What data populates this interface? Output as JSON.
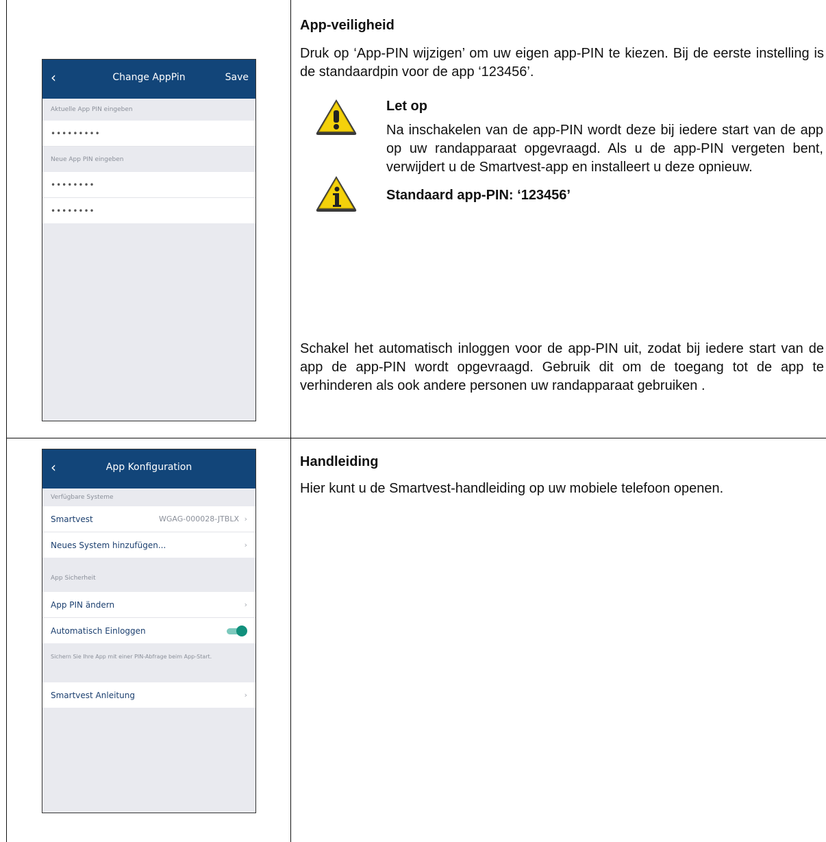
{
  "section1": {
    "phone": {
      "title": "Change AppPin",
      "back_icon": "‹",
      "save_label": "Save",
      "current_pin_label": "Aktuelle App PIN eingeben",
      "current_pin_value": "•••••••••",
      "new_pin_label": "Neue App PIN eingeben",
      "new_pin_value": "••••••••",
      "confirm_pin_value": "••••••••"
    },
    "heading": "App-veiligheid",
    "intro": "Druk op ‘App-PIN wijzigen’ om uw eigen app-PIN te kiezen. Bij de eerste instelling is de standaardpin voor de app ‘123456’.",
    "caution_title": "Let op",
    "caution_text": "Na inschakelen van de app-PIN wordt deze bij iedere start van de app op uw randapparaat opgevraagd. Als u de app-PIN vergeten bent, verwijdert u de Smartvest-app en installeert u deze opnieuw.",
    "info_text": "Standaard app-PIN: ‘123456’",
    "closing": "Schakel het automatisch inloggen voor de app-PIN uit, zodat bij iedere start van de app de app-PIN wordt opgevraagd. Gebruik dit om de toegang tot de app te verhinderen als ook andere personen uw randapparaat gebruiken ."
  },
  "section2": {
    "phone": {
      "title": "App Konfiguration",
      "back_icon": "‹",
      "systems_label": "Verfügbare Systeme",
      "smartvest_label": "Smartvest",
      "smartvest_value": "WGAG-000028-JTBLX",
      "add_system_label": "Neues System hinzufügen...",
      "security_label": "App Sicherheit",
      "change_pin_label": "App PIN ändern",
      "auto_login_label": "Automatisch Einloggen",
      "auto_login_enabled": true,
      "security_hint": "Sichern Sie Ihre App mit einer PIN-Abfrage beim App-Start.",
      "manual_label": "Smartvest Anleitung",
      "chevron": "›"
    },
    "heading": "Handleiding",
    "text": "Hier kunt u de Smartvest-handleiding op uw mobiele telefoon openen."
  },
  "colors": {
    "header_blue": "#124579",
    "toggle_green": "#11907c",
    "warning_yellow": "#f4d10b"
  }
}
